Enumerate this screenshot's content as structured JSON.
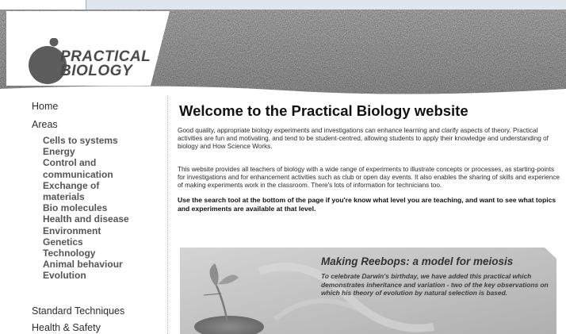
{
  "logo": {
    "line1": "PRACTICAL",
    "line2": "BIOLOGY"
  },
  "nav": {
    "home": "Home",
    "areas": "Areas",
    "area_items": [
      "Cells to systems",
      "Energy",
      "Control and",
      "communication",
      "Exchange of",
      "materials",
      "Bio molecules",
      "Health and disease",
      "Environment",
      "Genetics",
      "Technology",
      "Animal behaviour",
      "Evolution"
    ],
    "standard_techniques": "Standard Techniques",
    "health_safety": "Health & Safety"
  },
  "main": {
    "title": "Welcome to the Practical Biology website",
    "paragraph1": "Good quality, appropriate biology experiments and investigations can enhance learning and clarify aspects of theory. Practical activities are fun and motivating, and tend to be student-centred, allowing students to apply their knowledge and understanding of biology and How Science Works.",
    "paragraph2": "This website provides all teachers of biology with a wide range of experiments to illustrate concepts or processes, as starting-points for investigations and for enhancement activities such as club or open day events. It also enables the sharing of skills and experience of making experiments work in the classroom. There's lots of information for technicians too.",
    "paragraph3": "Use the search tool at the bottom of the page if you're know what level you are teaching, and want to see what topics and experiments are available at that level."
  },
  "banner": {
    "title": "Making Reebops: a model for meiosis",
    "description": "To celebrate Darwin's birthday, we have added this practical which demonstrates inheritance and variation - two of the key observations on which his theory of evolution by natural selection is based."
  },
  "colors": {
    "header_texture": "#6e6e6e",
    "logo_text": "#4a4a4a",
    "nav_text": "#2d2d2d",
    "area_text": "#555555",
    "top_bar": "#dfe6ee"
  }
}
